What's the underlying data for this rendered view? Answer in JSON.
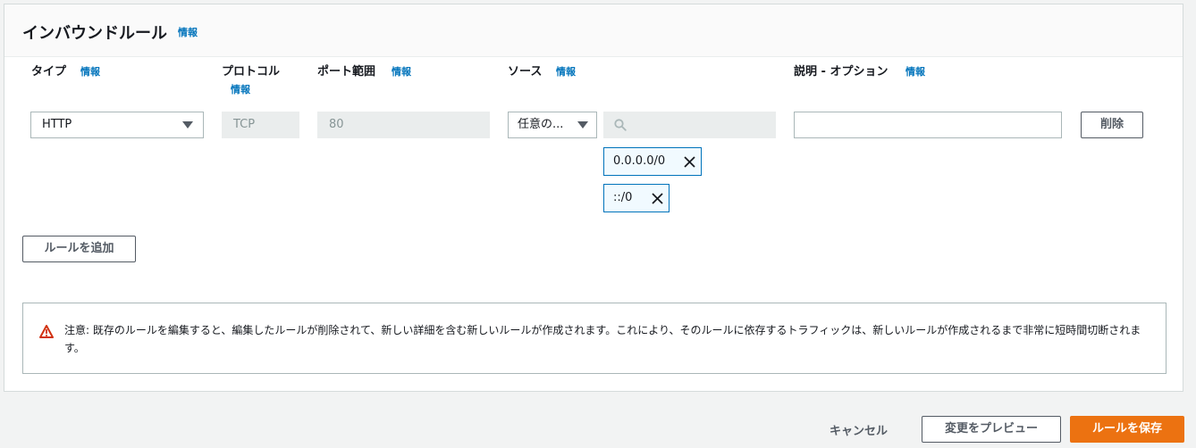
{
  "panel": {
    "title": "インバウンドルール",
    "info": "情報"
  },
  "columns": {
    "type": {
      "label": "タイプ",
      "info": "情報"
    },
    "protocol": {
      "label": "プロトコル",
      "info": "情報"
    },
    "port": {
      "label": "ポート範囲",
      "info": "情報"
    },
    "source": {
      "label": "ソース",
      "info": "情報"
    },
    "description": {
      "label": "説明 - オプション",
      "info": "情報"
    }
  },
  "rule": {
    "type_value": "HTTP",
    "protocol_value": "TCP",
    "port_value": "80",
    "source_select": "任意の...",
    "search_value": "",
    "cidrs": [
      "0.0.0.0/0",
      "::/0"
    ],
    "description_value": "",
    "delete_label": "削除"
  },
  "add_rule_label": "ルールを追加",
  "alert": {
    "text": "注意: 既存のルールを編集すると、編集したルールが削除されて、新しい詳細を含む新しいルールが作成されます。これにより、そのルールに依存するトラフィックは、新しいルールが作成されるまで非常に短時間切断されます。"
  },
  "footer": {
    "cancel": "キャンセル",
    "preview": "変更をプレビュー",
    "save": "ルールを保存"
  },
  "colors": {
    "accent": "#0073bb",
    "primary": "#ec7211",
    "warning": "#d13212"
  }
}
